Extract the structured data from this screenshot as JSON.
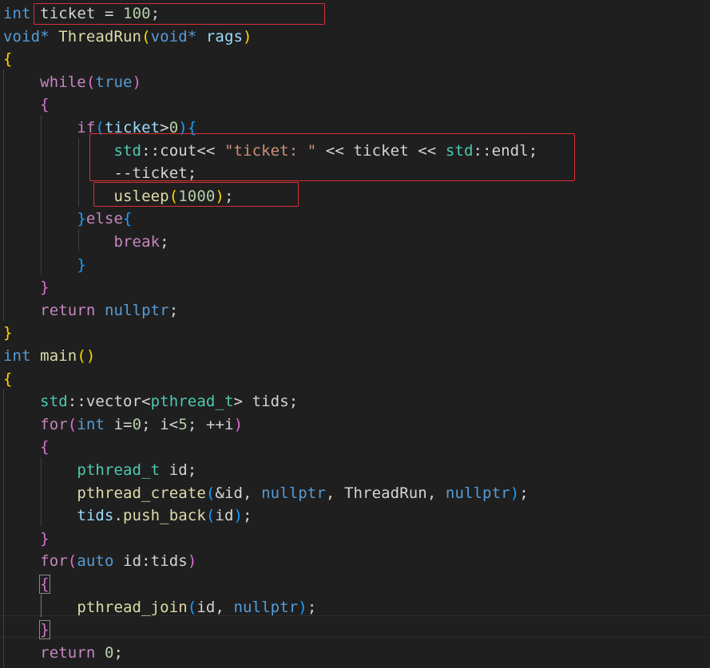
{
  "colors": {
    "background": "#1f1f1f",
    "keyword": "#569cd6",
    "control": "#c586c0",
    "function": "#dcdcaa",
    "type": "#4ec9b0",
    "variable": "#9cdcfe",
    "string": "#ce9178",
    "number": "#b5cea8",
    "plain": "#d4d4d4",
    "bracket_gold": "#ffd700",
    "bracket_purple": "#da70d6",
    "bracket_blue": "#179fff",
    "annotation_box": "#d8303a"
  },
  "code": {
    "lines": [
      [
        [
          "int",
          "kw"
        ],
        [
          " ",
          "pl"
        ],
        [
          "ticket",
          "pl"
        ],
        [
          " = ",
          "pl"
        ],
        [
          "100",
          "num"
        ],
        [
          ";",
          "pl"
        ]
      ],
      [
        [
          "void",
          "kw"
        ],
        [
          "* ",
          "kw"
        ],
        [
          "ThreadRun",
          "fn"
        ],
        [
          "(",
          "b1"
        ],
        [
          "void",
          "kw"
        ],
        [
          "* ",
          "kw"
        ],
        [
          "rags",
          "var"
        ],
        [
          ")",
          "b1"
        ]
      ],
      [
        [
          "{",
          "b1"
        ]
      ],
      [
        [
          "    ",
          "pl"
        ],
        [
          "while",
          "ctl"
        ],
        [
          "(",
          "b2"
        ],
        [
          "true",
          "kw"
        ],
        [
          ")",
          "b2"
        ]
      ],
      [
        [
          "    ",
          "pl"
        ],
        [
          "{",
          "b2"
        ]
      ],
      [
        [
          "        ",
          "pl"
        ],
        [
          "if",
          "ctl"
        ],
        [
          "(",
          "b3"
        ],
        [
          "ticket",
          "var"
        ],
        [
          ">",
          "pl"
        ],
        [
          "0",
          "num"
        ],
        [
          ")",
          "b3"
        ],
        [
          "{",
          "b3"
        ]
      ],
      [
        [
          "            ",
          "pl"
        ],
        [
          "std",
          "type"
        ],
        [
          "::",
          "pl"
        ],
        [
          "cout",
          "pl"
        ],
        [
          "<< ",
          "pl"
        ],
        [
          "\"ticket: \"",
          "str"
        ],
        [
          " << ",
          "pl"
        ],
        [
          "ticket",
          "pl"
        ],
        [
          " << ",
          "pl"
        ],
        [
          "std",
          "type"
        ],
        [
          "::",
          "pl"
        ],
        [
          "endl",
          "pl"
        ],
        [
          ";",
          "pl"
        ]
      ],
      [
        [
          "            ",
          "pl"
        ],
        [
          "--ticket",
          "pl"
        ],
        [
          ";",
          "pl"
        ]
      ],
      [
        [
          "            ",
          "pl"
        ],
        [
          "usleep",
          "fn"
        ],
        [
          "(",
          "b1"
        ],
        [
          "1000",
          "num"
        ],
        [
          ")",
          "b1"
        ],
        [
          ";",
          "pl"
        ]
      ],
      [
        [
          "        ",
          "pl"
        ],
        [
          "}",
          "b3"
        ],
        [
          "else",
          "ctl"
        ],
        [
          "{",
          "b3"
        ]
      ],
      [
        [
          "            ",
          "pl"
        ],
        [
          "break",
          "ctl"
        ],
        [
          ";",
          "pl"
        ]
      ],
      [
        [
          "        ",
          "pl"
        ],
        [
          "}",
          "b3"
        ]
      ],
      [
        [
          "    ",
          "pl"
        ],
        [
          "}",
          "b2"
        ]
      ],
      [
        [
          "    ",
          "pl"
        ],
        [
          "return",
          "ctl"
        ],
        [
          " ",
          "pl"
        ],
        [
          "nullptr",
          "kw"
        ],
        [
          ";",
          "pl"
        ]
      ],
      [
        [
          "}",
          "b1"
        ]
      ],
      [
        [
          "int",
          "kw"
        ],
        [
          " ",
          "pl"
        ],
        [
          "main",
          "fn"
        ],
        [
          "()",
          "b1"
        ]
      ],
      [
        [
          "{",
          "b1"
        ]
      ],
      [
        [
          "    ",
          "pl"
        ],
        [
          "std",
          "type"
        ],
        [
          "::",
          "pl"
        ],
        [
          "vector",
          "pl"
        ],
        [
          "<",
          "pl"
        ],
        [
          "pthread_t",
          "type"
        ],
        [
          "> ",
          "pl"
        ],
        [
          "tids",
          "pl"
        ],
        [
          ";",
          "pl"
        ]
      ],
      [
        [
          "    ",
          "pl"
        ],
        [
          "for",
          "ctl"
        ],
        [
          "(",
          "b2"
        ],
        [
          "int",
          "kw"
        ],
        [
          " ",
          "pl"
        ],
        [
          "i",
          "pl"
        ],
        [
          "=",
          "pl"
        ],
        [
          "0",
          "num"
        ],
        [
          "; ",
          "pl"
        ],
        [
          "i",
          "pl"
        ],
        [
          "<",
          "pl"
        ],
        [
          "5",
          "num"
        ],
        [
          "; ",
          "pl"
        ],
        [
          "++i",
          "pl"
        ],
        [
          ")",
          "b2"
        ]
      ],
      [
        [
          "    ",
          "pl"
        ],
        [
          "{",
          "b2"
        ]
      ],
      [
        [
          "        ",
          "pl"
        ],
        [
          "pthread_t",
          "type"
        ],
        [
          " ",
          "pl"
        ],
        [
          "id",
          "pl"
        ],
        [
          ";",
          "pl"
        ]
      ],
      [
        [
          "        ",
          "pl"
        ],
        [
          "pthread_create",
          "fn"
        ],
        [
          "(",
          "b3"
        ],
        [
          "&id",
          "pl"
        ],
        [
          ", ",
          "pl"
        ],
        [
          "nullptr",
          "kw"
        ],
        [
          ", ",
          "pl"
        ],
        [
          "ThreadRun",
          "pl"
        ],
        [
          ", ",
          "pl"
        ],
        [
          "nullptr",
          "kw"
        ],
        [
          ")",
          "b3"
        ],
        [
          ";",
          "pl"
        ]
      ],
      [
        [
          "        ",
          "pl"
        ],
        [
          "tids",
          "var"
        ],
        [
          ".",
          "pl"
        ],
        [
          "push_back",
          "fn"
        ],
        [
          "(",
          "b3"
        ],
        [
          "id",
          "pl"
        ],
        [
          ")",
          "b3"
        ],
        [
          ";",
          "pl"
        ]
      ],
      [
        [
          "    ",
          "pl"
        ],
        [
          "}",
          "b2"
        ]
      ],
      [
        [
          "    ",
          "pl"
        ],
        [
          "for",
          "ctl"
        ],
        [
          "(",
          "b2"
        ],
        [
          "auto",
          "kw"
        ],
        [
          " ",
          "pl"
        ],
        [
          "id",
          "pl"
        ],
        [
          ":",
          "pl"
        ],
        [
          "tids",
          "pl"
        ],
        [
          ")",
          "b2"
        ]
      ],
      [
        [
          "    ",
          "pl"
        ],
        [
          "{",
          "b2m"
        ]
      ],
      [
        [
          "        ",
          "pl"
        ],
        [
          "pthread_join",
          "fn"
        ],
        [
          "(",
          "b3"
        ],
        [
          "id",
          "pl"
        ],
        [
          ", ",
          "pl"
        ],
        [
          "nullptr",
          "kw"
        ],
        [
          ")",
          "b3"
        ],
        [
          ";",
          "pl"
        ]
      ],
      [
        [
          "    ",
          "pl"
        ],
        [
          "}",
          "b2m"
        ]
      ],
      [
        [
          "    ",
          "pl"
        ],
        [
          "return",
          "ctl"
        ],
        [
          " ",
          "pl"
        ],
        [
          "0",
          "num"
        ],
        [
          ";",
          "pl"
        ]
      ]
    ]
  }
}
